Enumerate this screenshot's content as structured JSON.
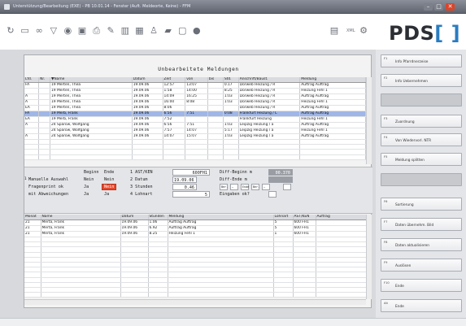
{
  "window": {
    "title": "Unterstützung/Bearbeitung (EXE) - PB 10.01.14 - Fenster (Auft. Meldeorte, Keine) - FFM",
    "buttons": [
      "–",
      "□",
      "✕"
    ]
  },
  "toolbar": {
    "icons": [
      "refresh-icon",
      "save-icon",
      "binoculars-icon",
      "filter-icon",
      "globe-icon",
      "print-preview-icon",
      "print-icon",
      "edit-icon",
      "trash-icon",
      "table-icon",
      "person-icon",
      "folder-icon",
      "monitor-icon",
      "record-icon"
    ],
    "right_icons": [
      "printer-icon",
      "xml-icon",
      "settings-icon"
    ],
    "xml_label": "XML",
    "logo": {
      "text": "PDS",
      "bracket": "[ ]"
    }
  },
  "main": {
    "heading": "Unbearbeitete Meldungen",
    "upper_table": {
      "columns": [
        "Lfd.",
        "Nr.",
        "▼Name",
        "Datum",
        "Zeit",
        "von",
        "bis",
        "Std.",
        "Anschrift/Baust.",
        "Meldung"
      ],
      "rows": [
        {
          "c": [
            "FA",
            "",
            "19 Merten, Thea",
            "19.09.06",
            "12:57",
            "13:07",
            "",
            "0.17",
            "Dorweb Heizung / R",
            "Auftrag Auftrag"
          ],
          "sel": false
        },
        {
          "c": [
            "",
            "",
            "19 Merten, Thea",
            "19.09.06",
            "1:58",
            "14:00",
            "",
            "8:25",
            "Dorweb Heizung / R",
            "Heizung Fehl 1"
          ],
          "sel": false
        },
        {
          "c": [
            "A",
            "",
            "19 Merten, Thea",
            "19.09.06",
            "14:09",
            "16:25",
            "",
            "1:03",
            "Dorweb Heizung / R",
            "Auftrag Auftrag"
          ],
          "sel": false
        },
        {
          "c": [
            "A",
            "",
            "19 Merten, Thea",
            "19.09.06",
            "16:00",
            "8:08",
            "",
            "1:03",
            "Dorweb Heizung / R",
            "Heizung Fehl 1"
          ],
          "sel": false
        },
        {
          "c": [
            "EA",
            "",
            "19 Merten, Thea",
            "19.09.06",
            "8:06",
            "",
            "",
            "",
            "Dorweb Heizung / R",
            "Auftrag Auftrag"
          ],
          "sel": false
        },
        {
          "c": [
            "FA",
            "",
            "19 Merb, Frank",
            "19.09.06",
            "6:56",
            "7:51",
            "",
            "0:08",
            "Frankfurt Heizung / L",
            "Auftrag Auftrag"
          ],
          "sel": true
        },
        {
          "c": [
            "EA",
            "",
            "19 Merb, Frank",
            "19.09.06",
            "7:52",
            "",
            "",
            "",
            "Frankfurt Heizung",
            "Heizung Fehl 1"
          ],
          "sel": false
        },
        {
          "c": [
            "A",
            "",
            "24 Sparow, Wolfgang",
            "19.09.06",
            "6:56",
            "7:51",
            "",
            "1:03",
            "Leipzig Heizung / a",
            "Auftrag Auftrag"
          ],
          "sel": false
        },
        {
          "c": [
            "",
            "",
            "24 Sparow, Wolfgang",
            "19.09.06",
            "7:57",
            "14:07",
            "",
            "5:17",
            "Leipzig Heizung / a",
            "Heizung Fehl 1"
          ],
          "sel": false
        },
        {
          "c": [
            "A",
            "",
            "24 Sparow, Wolfgang",
            "19.09.06",
            "14:07",
            "15:07",
            "",
            "1:03",
            "Leipzig Heizung / a",
            "Auftrag Auftrag"
          ],
          "sel": false
        }
      ]
    },
    "form": {
      "head_col1": "Beginn",
      "head_col2": "Ende",
      "row_marker": "1",
      "rows": [
        {
          "label": "Manuelle Auswahl",
          "v1": "Nein",
          "v2": "Nein"
        },
        {
          "label": "Fragenprint ok",
          "v1": "Ja",
          "v2": "Nein"
        },
        {
          "label": "mit Abweichungen",
          "v1": "Ja",
          "v2": "Ja"
        }
      ],
      "fields": [
        {
          "label": "1 AST/KEN",
          "value": "600FH1"
        },
        {
          "label": "2 Datum",
          "value": "19.09.06"
        },
        {
          "label": "3 Stunden",
          "value": "0.46"
        },
        {
          "label": "4 Lohnart",
          "value": "5"
        }
      ],
      "right": [
        {
          "label": "Diff-Beginn m",
          "value": "00.370"
        },
        {
          "label": "Diff-Ende m",
          "value": ""
        },
        {
          "label": "Eingaben ok?",
          "value": ""
        }
      ],
      "mini_buttons": [
        "Ber.",
        "—",
        "Ende",
        "Ber.",
        "—"
      ]
    },
    "lower_table": {
      "columns": [
        "Monat",
        "Name",
        "Datum",
        "Stunden",
        "Meldung",
        "Lohnart",
        "AST/KEN",
        "Auftrag"
      ],
      "rows": [
        [
          "21",
          "Merta, Frank",
          "19.09.06",
          "1.06",
          "Auftrag Auftrag",
          "5",
          "600 FH1",
          ""
        ],
        [
          "21",
          "Merta, Frank",
          "19.09.06",
          "6.92",
          "Auftrag Auftrag",
          "5",
          "600 FH1",
          ""
        ],
        [
          "21",
          "Merta, Frank",
          "19.09.06",
          "8.25",
          "Heizung Fehl 1",
          "1",
          "600 FH1",
          ""
        ]
      ]
    }
  },
  "sidebar": {
    "buttons": [
      {
        "key": "F1",
        "label": "Info Pfarrdnerzeise"
      },
      {
        "key": "F2",
        "label": "Info Uebernehmen"
      },
      {
        "key": "",
        "label": ""
      },
      {
        "key": "F3",
        "label": "Zuordnung"
      },
      {
        "key": "F4",
        "label": "Von Wiedervorl. NTR"
      },
      {
        "key": "F5",
        "label": "Meldung splitten"
      },
      {
        "key": "",
        "label": ""
      },
      {
        "key": "F6",
        "label": "Sortierung"
      },
      {
        "key": "F7",
        "label": "Daten übernehm. Bild"
      },
      {
        "key": "F8",
        "label": "Daten aktualisieren"
      },
      {
        "key": "F9",
        "label": "Auslösen"
      },
      {
        "key": "F10",
        "label": "Ende"
      },
      {
        "key": "Alt",
        "label": "Ende"
      }
    ]
  }
}
